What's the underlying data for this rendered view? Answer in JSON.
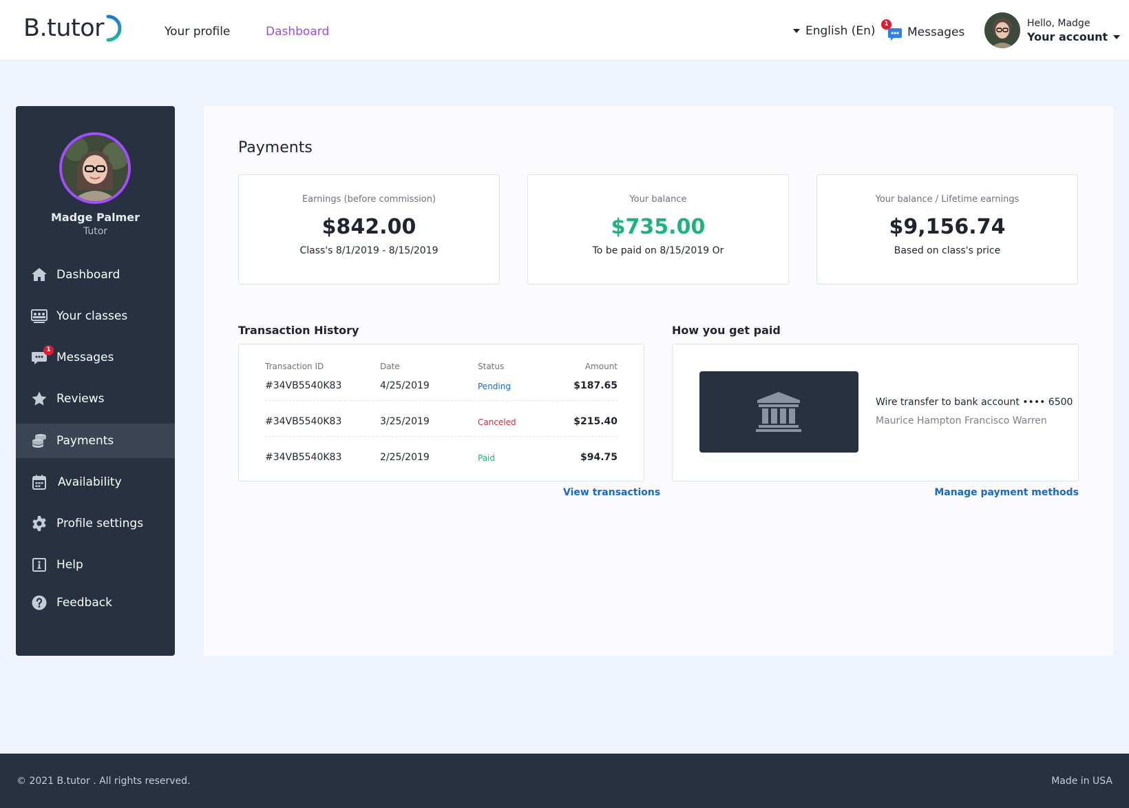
{
  "brand": {
    "logo_text": "B.tutor"
  },
  "header": {
    "nav": [
      {
        "label": "Your profile"
      },
      {
        "label": "Dashboard"
      }
    ],
    "language": "English (En)",
    "messages_label": "Messages",
    "messages_count": "1",
    "hello": "Hello,  Madge",
    "account_label": "Your account"
  },
  "sidebar": {
    "name": "Madge Palmer",
    "role": "Tutor",
    "items": [
      {
        "label": "Dashboard",
        "icon": "home-icon"
      },
      {
        "label": "Your classes",
        "icon": "classes-icon"
      },
      {
        "label": "Messages",
        "icon": "chat-icon",
        "badge": "1"
      },
      {
        "label": "Reviews",
        "icon": "star-icon"
      },
      {
        "label": "Payments",
        "icon": "coins-icon"
      },
      {
        "label": "Availability",
        "icon": "calendar-icon"
      },
      {
        "label": "Profile settings",
        "icon": "gear-icon"
      },
      {
        "label": "Help",
        "icon": "info-icon"
      },
      {
        "label": "Feedback",
        "icon": "question-icon"
      }
    ]
  },
  "main": {
    "title": "Payments",
    "stats": [
      {
        "label": "Earnings (before commission)",
        "value": "$842.00",
        "sub": "Class's 8/1/2019 - 8/15/2019"
      },
      {
        "label": "Your balance",
        "value": "$735.00",
        "sub": "To be paid on 8/15/2019 Or"
      },
      {
        "label": "Your balance / Lifetime earnings",
        "value": "$9,156.74",
        "sub": "Based on class's price"
      }
    ],
    "transactions": {
      "title": "Transaction History",
      "headers": {
        "id": "Transaction ID",
        "date": "Date",
        "status": "Status",
        "amount": "Amount"
      },
      "rows": [
        {
          "id": "#34VB5540K83",
          "date": "4/25/2019",
          "status": "Pending",
          "amount": "$187.65"
        },
        {
          "id": "#34VB5540K83",
          "date": "3/25/2019",
          "status": "Canceled",
          "amount": "$215.40"
        },
        {
          "id": "#34VB5540K83",
          "date": "2/25/2019",
          "status": "Paid",
          "amount": "$94.75"
        }
      ],
      "link": "View transactions"
    },
    "payout": {
      "title": "How you get paid",
      "method": "Wire transfer to bank account •••• 6500",
      "account_holder": "Maurice Hampton Francisco Warren",
      "link": "Manage payment methods"
    }
  },
  "footer": {
    "copyright": "© 2021 B.tutor  . All rights reserved.",
    "made_in": "Made in USA"
  },
  "colors": {
    "accent": "#9b4fd6",
    "sidebar_bg": "#273142",
    "link": "#1769c8",
    "positive": "#1bb57c",
    "pending": "#1769c8",
    "canceled": "#d0283a",
    "paid": "#1bb57c"
  }
}
